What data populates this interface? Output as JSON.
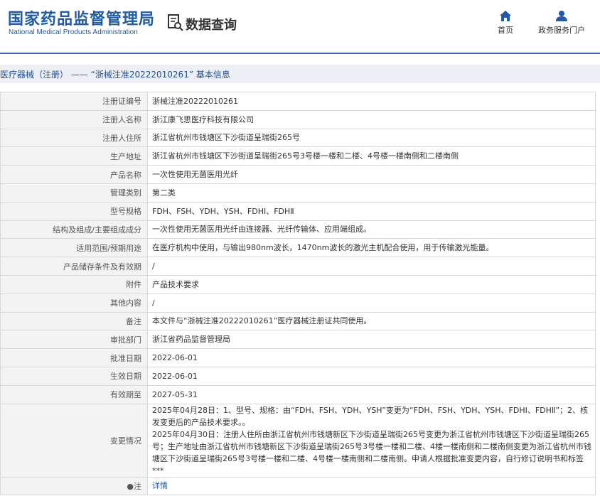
{
  "header": {
    "logo_cn": "国家药品监督管理局",
    "logo_en": "National Medical Products Administration",
    "query_label": "数据查询",
    "nav": [
      {
        "label": "首页",
        "icon": "home-icon"
      },
      {
        "label": "政务服务门户",
        "icon": "user-icon"
      }
    ],
    "brand_color": "#1f5ba8"
  },
  "title": "医疗器械（注册） —— “浙械注准20222010261”  基本信息",
  "rows": [
    {
      "key": "注册证编号",
      "value": "浙械注准20222010261"
    },
    {
      "key": "注册人名称",
      "value": "浙江康飞思医疗科技有限公司"
    },
    {
      "key": "注册人住所",
      "value": "浙江省杭州市钱塘区下沙街道呈瑞街265号"
    },
    {
      "key": "生产地址",
      "value": "浙江省杭州市钱塘区下沙街道呈瑞街265号3号楼一楼和二楼、4号楼一楼南侧和二楼南侧"
    },
    {
      "key": "产品名称",
      "value": "一次性使用无菌医用光纤"
    },
    {
      "key": "管理类别",
      "value": "第二类"
    },
    {
      "key": "型号规格",
      "value": "FDH、FSH、YDH、YSH、FDHⅠ、FDHⅡ"
    },
    {
      "key": "结构及组成/主要组成成分",
      "value": "一次性使用无菌医用光纤由连接器、光纤传输体、应用端组成。"
    },
    {
      "key": "适用范围/预期用途",
      "value": "在医疗机构中使用，与输出980nm波长，1470nm波长的激光主机配合使用，用于传输激光能量。"
    },
    {
      "key": "产品储存条件及有效期",
      "value": "/"
    },
    {
      "key": "附件",
      "value": "产品技术要求"
    },
    {
      "key": "其他内容",
      "value": "/"
    },
    {
      "key": "备注",
      "value": "本文件与“浙械注准20222010261”医疗器械注册证共同使用。"
    },
    {
      "key": "审批部门",
      "value": "浙江省药品监督管理局"
    },
    {
      "key": "批准日期",
      "value": "2022-06-01"
    },
    {
      "key": "生效日期",
      "value": "2022-06-01"
    },
    {
      "key": "有效期至",
      "value": "2027-05-31"
    },
    {
      "key": "变更情况",
      "value": "2025年04月28日：1、型号、规格：由“FDH、FSH、YDH、YSH”变更为“FDH、FSH、YDH、YSH、FDHⅠ、FDHⅡ”；2、核发变更后的产品技术要求。。\n2025年04月30日：注册人住所由浙江省杭州市钱塘新区下沙街道呈瑞街265号变更为浙江省杭州市钱塘区下沙街道呈瑞街265号；生产地址由浙江省杭州市钱塘新区下沙街道呈瑞街265号3号楼一楼和二楼、4楼一楼南侧和二楼南侧变更为浙江省杭州市钱塘区下沙街道呈瑞街265号3号楼一楼和二楼、4号楼一楼南侧和二楼南侧。申请人根据批准变更内容，自行修订说明书和标签***"
    }
  ],
  "last_row": {
    "key": "注",
    "value": "详情"
  }
}
